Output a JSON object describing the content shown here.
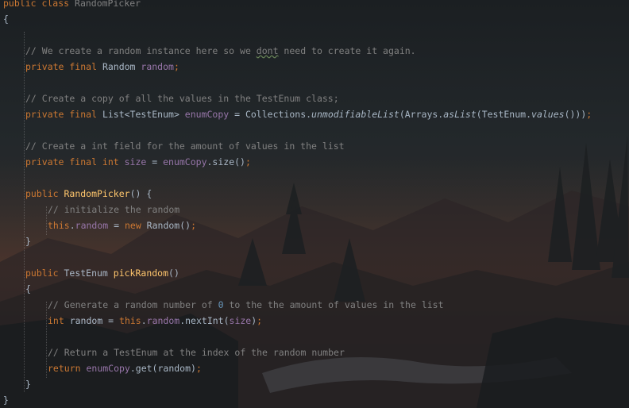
{
  "editor": {
    "lines": [
      {
        "indent": 0,
        "tokens": [
          {
            "t": "public class ",
            "c": "kw"
          },
          {
            "t": "RandomPicker",
            "c": "cm"
          }
        ]
      },
      {
        "indent": 0,
        "tokens": [
          {
            "t": "{",
            "c": "pl"
          }
        ]
      },
      {
        "indent": 0,
        "tokens": []
      },
      {
        "indent": 1,
        "tokens": [
          {
            "t": "// We create a random instance here so we ",
            "c": "cm"
          },
          {
            "t": "dont",
            "c": "cm wavy"
          },
          {
            "t": " need to create it again.",
            "c": "cm"
          }
        ]
      },
      {
        "indent": 1,
        "tokens": [
          {
            "t": "private final ",
            "c": "kw"
          },
          {
            "t": "Random ",
            "c": "pl"
          },
          {
            "t": "random",
            "c": "fld"
          },
          {
            "t": ";",
            "c": "kw"
          }
        ]
      },
      {
        "indent": 0,
        "tokens": []
      },
      {
        "indent": 1,
        "tokens": [
          {
            "t": "// Create a copy of all the values in the TestEnum class;",
            "c": "cm"
          }
        ]
      },
      {
        "indent": 1,
        "tokens": [
          {
            "t": "private final ",
            "c": "kw"
          },
          {
            "t": "List<TestEnum> ",
            "c": "pl"
          },
          {
            "t": "enumCopy",
            "c": "fld"
          },
          {
            "t": " = Collections.",
            "c": "pl"
          },
          {
            "t": "unmodifiableList",
            "c": "it"
          },
          {
            "t": "(Arrays.",
            "c": "pl"
          },
          {
            "t": "asList",
            "c": "it"
          },
          {
            "t": "(TestEnum.",
            "c": "pl"
          },
          {
            "t": "values",
            "c": "it"
          },
          {
            "t": "()))",
            "c": "pl"
          },
          {
            "t": ";",
            "c": "kw"
          }
        ]
      },
      {
        "indent": 0,
        "tokens": []
      },
      {
        "indent": 1,
        "tokens": [
          {
            "t": "// Create a int field for the amount of values in the list",
            "c": "cm"
          }
        ]
      },
      {
        "indent": 1,
        "tokens": [
          {
            "t": "private final int ",
            "c": "kw"
          },
          {
            "t": "size",
            "c": "fld"
          },
          {
            "t": " = ",
            "c": "pl"
          },
          {
            "t": "enumCopy",
            "c": "fld"
          },
          {
            "t": ".size()",
            "c": "pl"
          },
          {
            "t": ";",
            "c": "kw"
          }
        ]
      },
      {
        "indent": 0,
        "tokens": []
      },
      {
        "indent": 1,
        "tokens": [
          {
            "t": "public ",
            "c": "kw"
          },
          {
            "t": "RandomPicker",
            "c": "mth"
          },
          {
            "t": "() {",
            "c": "pl"
          }
        ]
      },
      {
        "indent": 2,
        "tokens": [
          {
            "t": "// initialize the random",
            "c": "cm"
          }
        ]
      },
      {
        "indent": 2,
        "tokens": [
          {
            "t": "this",
            "c": "kw"
          },
          {
            "t": ".",
            "c": "pl"
          },
          {
            "t": "random",
            "c": "fld"
          },
          {
            "t": " = ",
            "c": "pl"
          },
          {
            "t": "new ",
            "c": "kw"
          },
          {
            "t": "Random()",
            "c": "pl"
          },
          {
            "t": ";",
            "c": "kw"
          }
        ]
      },
      {
        "indent": 1,
        "tokens": [
          {
            "t": "}",
            "c": "pl"
          }
        ]
      },
      {
        "indent": 0,
        "tokens": []
      },
      {
        "indent": 1,
        "tokens": [
          {
            "t": "public ",
            "c": "kw"
          },
          {
            "t": "TestEnum ",
            "c": "pl"
          },
          {
            "t": "pickRandom",
            "c": "mth"
          },
          {
            "t": "()",
            "c": "pl"
          }
        ]
      },
      {
        "indent": 1,
        "tokens": [
          {
            "t": "{",
            "c": "pl"
          }
        ]
      },
      {
        "indent": 2,
        "tokens": [
          {
            "t": "// Generate a random number of ",
            "c": "cm"
          },
          {
            "t": "0",
            "c": "num"
          },
          {
            "t": " to the the amount of values in the list",
            "c": "cm"
          }
        ]
      },
      {
        "indent": 2,
        "tokens": [
          {
            "t": "int ",
            "c": "kw"
          },
          {
            "t": "random = ",
            "c": "pl"
          },
          {
            "t": "this",
            "c": "kw"
          },
          {
            "t": ".",
            "c": "pl"
          },
          {
            "t": "random",
            "c": "fld"
          },
          {
            "t": ".nextInt(",
            "c": "pl"
          },
          {
            "t": "size",
            "c": "fld"
          },
          {
            "t": ")",
            "c": "pl"
          },
          {
            "t": ";",
            "c": "kw"
          }
        ]
      },
      {
        "indent": 0,
        "tokens": []
      },
      {
        "indent": 2,
        "tokens": [
          {
            "t": "// Return a TestEnum at the index of the random number",
            "c": "cm"
          }
        ]
      },
      {
        "indent": 2,
        "tokens": [
          {
            "t": "return ",
            "c": "kw"
          },
          {
            "t": "enumCopy",
            "c": "fld"
          },
          {
            "t": ".get(random)",
            "c": "pl"
          },
          {
            "t": ";",
            "c": "kw"
          }
        ]
      },
      {
        "indent": 1,
        "tokens": [
          {
            "t": "}",
            "c": "pl"
          }
        ]
      },
      {
        "indent": 0,
        "tokens": [
          {
            "t": "}",
            "c": "pl"
          }
        ]
      }
    ]
  }
}
